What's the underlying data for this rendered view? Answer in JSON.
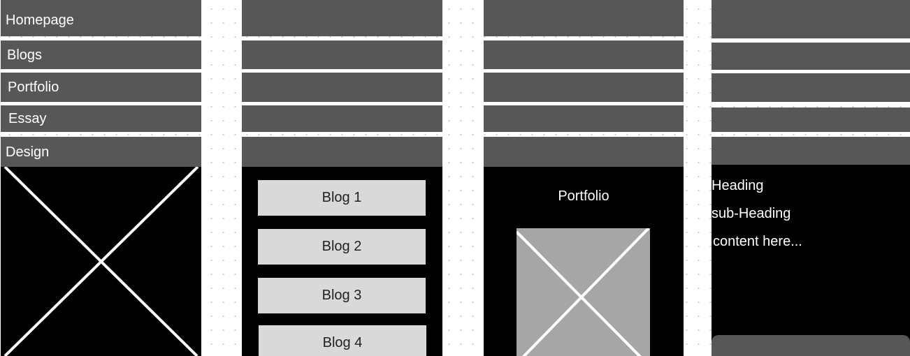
{
  "panels": {
    "home": {
      "nav": [
        "Homepage",
        "Blogs",
        "Portfolio",
        "Essay",
        "Design"
      ]
    },
    "blogs": {
      "items": [
        "Blog 1",
        "Blog 2",
        "Blog 3",
        "Blog 4"
      ]
    },
    "portfolio": {
      "title": "Portfolio"
    },
    "article": {
      "heading": "Heading",
      "subheading": "sub-Heading",
      "content": "content here..."
    }
  }
}
